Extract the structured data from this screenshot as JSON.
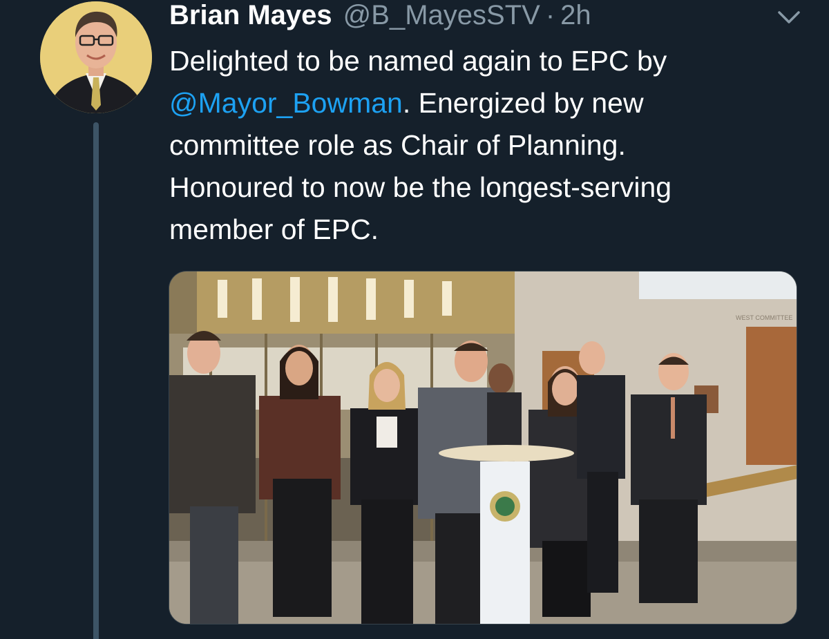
{
  "author": {
    "display_name": "Brian Mayes",
    "handle": "@B_MayesSTV",
    "separator": "·",
    "time": "2h"
  },
  "icons": {
    "avatar": "profile-photo",
    "menu": "chevron-down-icon"
  },
  "tweet": {
    "line1": "Delighted to be named again to EPC by",
    "mention": "@Mayor_Bowman",
    "line2_rest": ". Energized by new",
    "line3": "committee role as Chair of Planning.",
    "line4": "Honoured to now be the longest-serving",
    "line5": "member of EPC."
  },
  "media": {
    "sign_text": "WEST COMMITTEE"
  },
  "colors": {
    "background": "#15202b",
    "text": "#ffffff",
    "secondary_text": "#8899a6",
    "link": "#1da1f2"
  }
}
